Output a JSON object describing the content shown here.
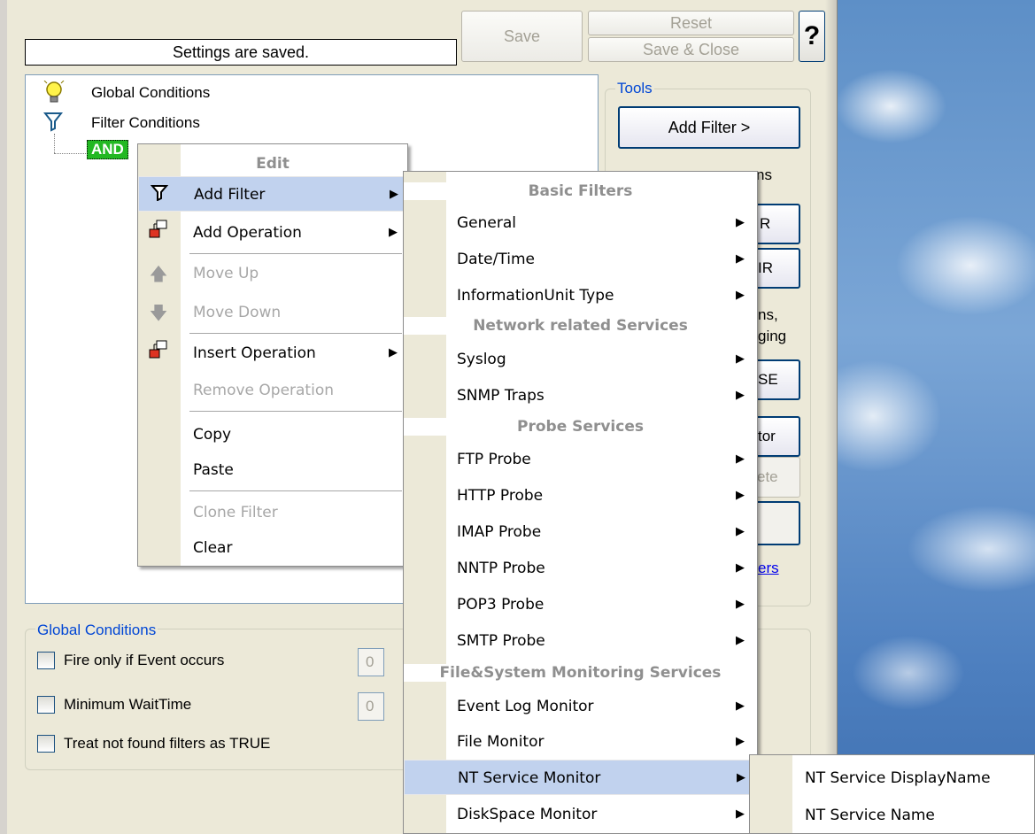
{
  "toolbar": {
    "status_text": "Settings are saved.",
    "save_label": "Save",
    "reset_label": "Reset",
    "save_close_label": "Save & Close",
    "help_label": "?"
  },
  "tree": {
    "global_conditions": "Global Conditions",
    "filter_conditions": "Filter Conditions",
    "and_node": "AND"
  },
  "tools": {
    "title": "Tools",
    "add_filter_label": "Add Filter >",
    "frag_add_operations": "ns",
    "frag_btn1": "R",
    "frag_btn2": "IR",
    "frag_text1": "ns,",
    "frag_text2": "ging",
    "frag_btn3": "SE",
    "frag_btn4": "tor",
    "frag_btn5": "ete",
    "frag_link": "ers"
  },
  "global_conditions": {
    "title": "Global Conditions",
    "fire_label": "Fire only if Event occurs",
    "fire_value": "0",
    "min_wait_label": "Minimum WaitTime",
    "min_wait_value": "0",
    "treat_label": "Treat not found filters as TRUE"
  },
  "edit_menu": {
    "header": "Edit",
    "items": {
      "add_filter": "Add Filter",
      "add_operation": "Add Operation",
      "move_up": "Move Up",
      "move_down": "Move Down",
      "insert_operation": "Insert Operation",
      "remove_operation": "Remove Operation",
      "copy": "Copy",
      "paste": "Paste",
      "clone_filter": "Clone Filter",
      "clear": "Clear"
    }
  },
  "filters_menu": {
    "basic_header": "Basic Filters",
    "network_header": "Network related Services",
    "probe_header": "Probe Services",
    "filesys_header": "File&System Monitoring Services",
    "items": {
      "general": "General",
      "datetime": "Date/Time",
      "infounit": "InformationUnit Type",
      "syslog": "Syslog",
      "snmp": "SNMP Traps",
      "ftp": "FTP Probe",
      "http": "HTTP Probe",
      "imap": "IMAP Probe",
      "nntp": "NNTP Probe",
      "pop3": "POP3 Probe",
      "smtp": "SMTP Probe",
      "eventlog": "Event Log Monitor",
      "filemon": "File Monitor",
      "ntservice": "NT Service Monitor",
      "diskspace": "DiskSpace Monitor"
    }
  },
  "nt_menu": {
    "display_name": "NT Service DisplayName",
    "service_name": "NT Service Name"
  },
  "colors": {
    "menu_highlight": "#c1d2ee",
    "group_title": "#0046d5",
    "and_badge": "#22b822"
  }
}
